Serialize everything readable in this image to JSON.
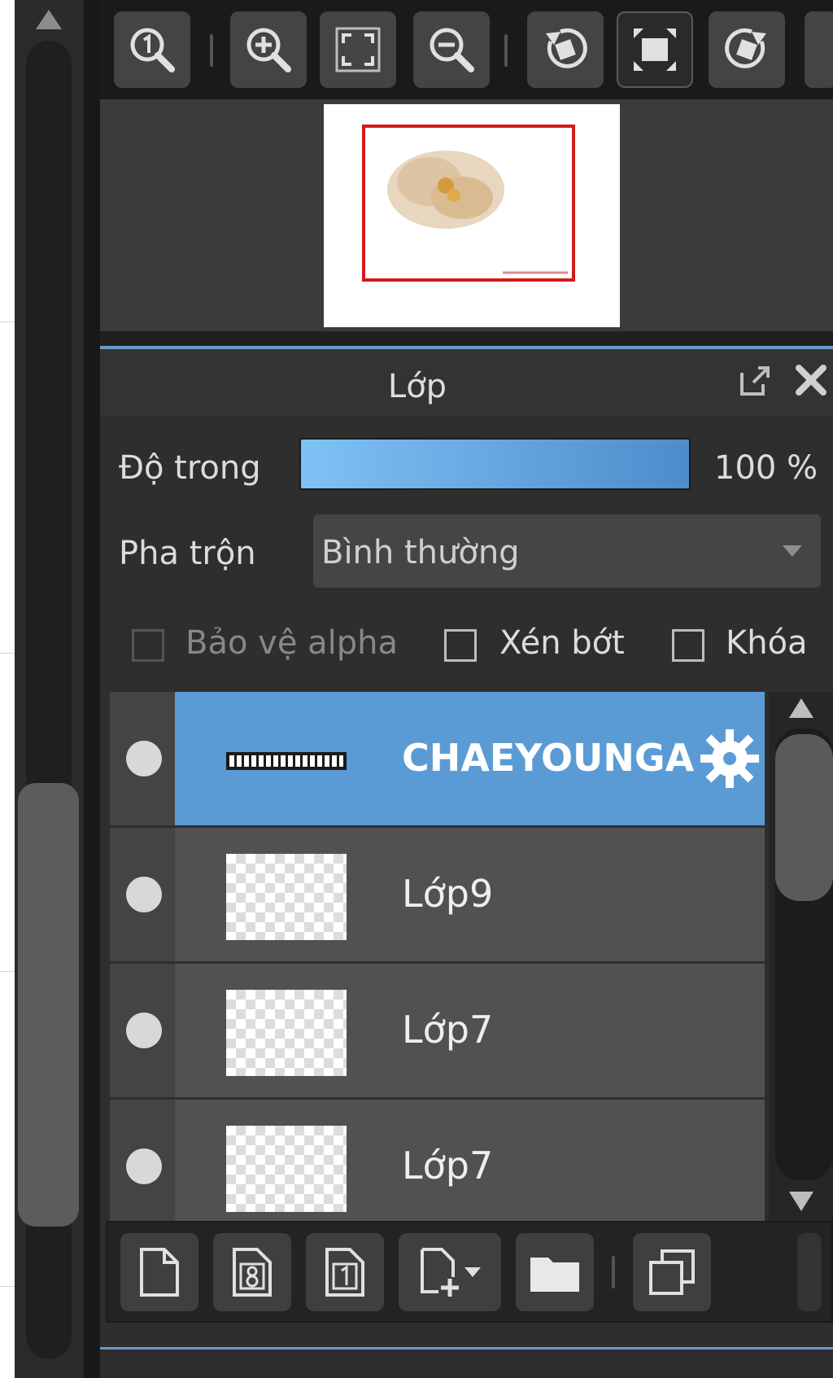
{
  "toolbar": {
    "buttons": [
      {
        "name": "actual-size",
        "icon": "zoom-one-icon"
      },
      {
        "name": "zoom-in",
        "icon": "zoom-in-icon"
      },
      {
        "name": "fit-window",
        "icon": "fit-screen-icon"
      },
      {
        "name": "zoom-out",
        "icon": "zoom-out-icon"
      },
      {
        "name": "rotate-left",
        "icon": "rotate-left-icon"
      },
      {
        "name": "fullscreen",
        "icon": "fullscreen-icon",
        "active": true
      },
      {
        "name": "rotate-right",
        "icon": "rotate-right-icon"
      }
    ]
  },
  "navigator": {
    "frame_color": "#d21b1b"
  },
  "layer_panel": {
    "title": "Lớp",
    "opacity_label": "Độ trong",
    "opacity_value": "100 %",
    "blend_label": "Pha trộn",
    "blend_value": "Bình thường",
    "protect_alpha_label": "Bảo vệ alpha",
    "clip_label": "Xén bớt",
    "lock_label": "Khóa",
    "layers": [
      {
        "name": "CHAEYOUNGA",
        "selected": true
      },
      {
        "name": "Lớp9",
        "selected": false
      },
      {
        "name": "Lớp7",
        "selected": false
      },
      {
        "name": "Lớp7",
        "selected": false
      }
    ]
  },
  "colors": {
    "accent": "#5b9bd5",
    "panel_bg": "#2e2e2e"
  }
}
